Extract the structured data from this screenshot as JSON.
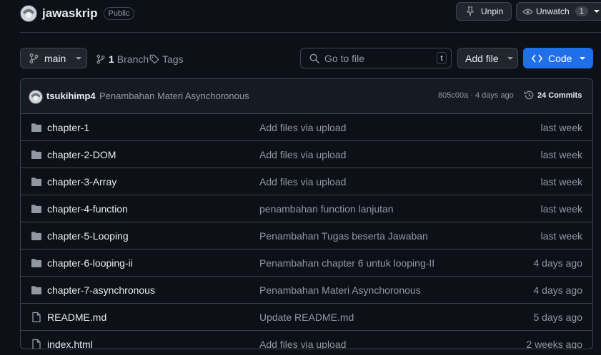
{
  "repo": {
    "name": "jawaskrip",
    "visibility": "Public"
  },
  "header_actions": {
    "unpin_label": "Unpin",
    "unwatch_label": "Unwatch",
    "watch_count": "1"
  },
  "toolbar": {
    "branch_label": "main",
    "branches_count": "1",
    "branches_label": "Branch",
    "tags_label": "Tags",
    "search_placeholder": "Go to file",
    "search_shortcut": "t",
    "add_file_label": "Add file",
    "code_label": "Code"
  },
  "latest_commit": {
    "author": "tsukihimp4",
    "message": "Penambahan Materi Asynchoronous",
    "hash_time": "805c00a · 4 days ago",
    "commits_count": "24",
    "commits_label": "Commits"
  },
  "files": [
    {
      "name": "chapter-1",
      "type": "folder",
      "message": "Add files via upload",
      "date": "last week"
    },
    {
      "name": "chapter-2-DOM",
      "type": "folder",
      "message": "Add files via upload",
      "date": "last week"
    },
    {
      "name": "chapter-3-Array",
      "type": "folder",
      "message": "Add files via upload",
      "date": "last week"
    },
    {
      "name": "chapter-4-function",
      "type": "folder",
      "message": "penambahan function lanjutan",
      "date": "last week"
    },
    {
      "name": "chapter-5-Looping",
      "type": "folder",
      "message": "Penambahan Tugas beserta Jawaban",
      "date": "last week"
    },
    {
      "name": "chapter-6-looping-ii",
      "type": "folder",
      "message": "Penambahan chapter 6 untuk looping-II",
      "date": "4 days ago"
    },
    {
      "name": "chapter-7-asynchronous",
      "type": "folder",
      "message": "Penambahan Materi Asynchoronous",
      "date": "4 days ago"
    },
    {
      "name": "README.md",
      "type": "file",
      "message": "Update README.md",
      "date": "5 days ago"
    },
    {
      "name": "index.html",
      "type": "file",
      "message": "Add files via upload",
      "date": "2 weeks ago"
    }
  ],
  "colors": {
    "background": "#0d1117",
    "accent": "#1f6feb",
    "border": "#3d444d",
    "muted": "#9198a1",
    "folder": "#9198a1"
  }
}
